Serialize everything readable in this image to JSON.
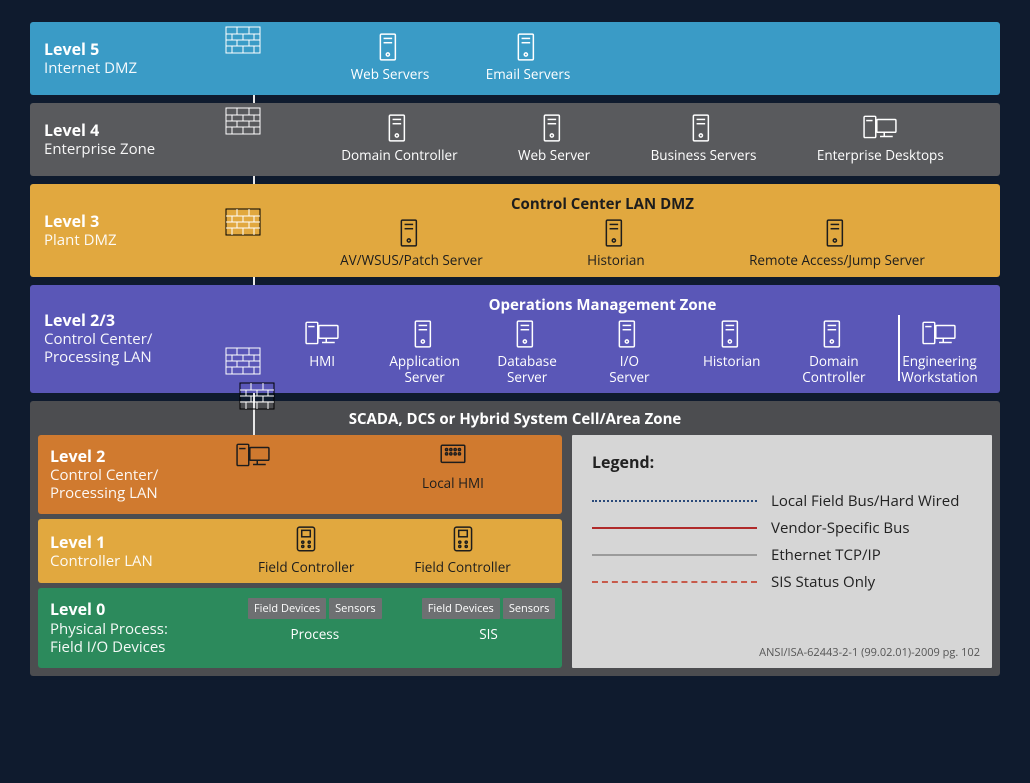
{
  "levels": {
    "l5": {
      "title": "Level 5",
      "subtitle": "Internet DMZ",
      "nodes": {
        "web": "Web Servers",
        "email": "Email Servers"
      }
    },
    "l4": {
      "title": "Level 4",
      "subtitle": "Enterprise Zone",
      "nodes": {
        "dc": "Domain Controller",
        "web": "Web Server",
        "biz": "Business Servers",
        "desk": "Enterprise Desktops"
      }
    },
    "l3": {
      "title": "Level 3",
      "subtitle": "Plant DMZ",
      "header": "Control Center LAN DMZ",
      "nodes": {
        "av": "AV/WSUS/Patch Server",
        "hist": "Historian",
        "remote": "Remote Access/Jump Server"
      }
    },
    "l23": {
      "title": "Level 2/3",
      "subtitle1": "Control Center/",
      "subtitle2": "Processing LAN",
      "header": "Operations Management Zone",
      "nodes": {
        "hmi": "HMI",
        "app1": "Application",
        "app2": "Server",
        "db1": "Database",
        "db2": "Server",
        "io1": "I/O",
        "io2": "Server",
        "hist": "Historian",
        "dc1": "Domain",
        "dc2": "Controller",
        "eng1": "Engineering",
        "eng2": "Workstation"
      }
    },
    "outer": {
      "header": "SCADA, DCS or Hybrid System Cell/Area Zone"
    },
    "l2": {
      "title": "Level 2",
      "subtitle1": "Control Center/",
      "subtitle2": "Processing LAN",
      "nodes": {
        "localhmi": "Local HMI"
      }
    },
    "l1": {
      "title": "Level 1",
      "subtitle": "Controller LAN",
      "nodes": {
        "fc1": "Field Controller",
        "fc2": "Field Controller"
      }
    },
    "l0": {
      "title": "Level 0",
      "subtitle1": "Physical Process:",
      "subtitle2": "Field I/O Devices",
      "nodes": {
        "fd": "Field Devices",
        "sens": "Sensors",
        "proc": "Process",
        "sis": "SIS"
      }
    }
  },
  "legend": {
    "title": "Legend:",
    "items": {
      "fieldbus": "Local Field Bus/Hard Wired",
      "vendor": "Vendor-Specific Bus",
      "eth": "Ethernet TCP/IP",
      "sis": "SIS Status Only"
    },
    "footnote": "ANSI/ISA-62443-2-1 (99.02.01)-2009 pg. 102"
  },
  "colors": {
    "fieldbus": "#2a4a7a",
    "vendor": "#b02a2a",
    "ethernet": "#cfcfcf",
    "sis": "#c75a4a"
  }
}
